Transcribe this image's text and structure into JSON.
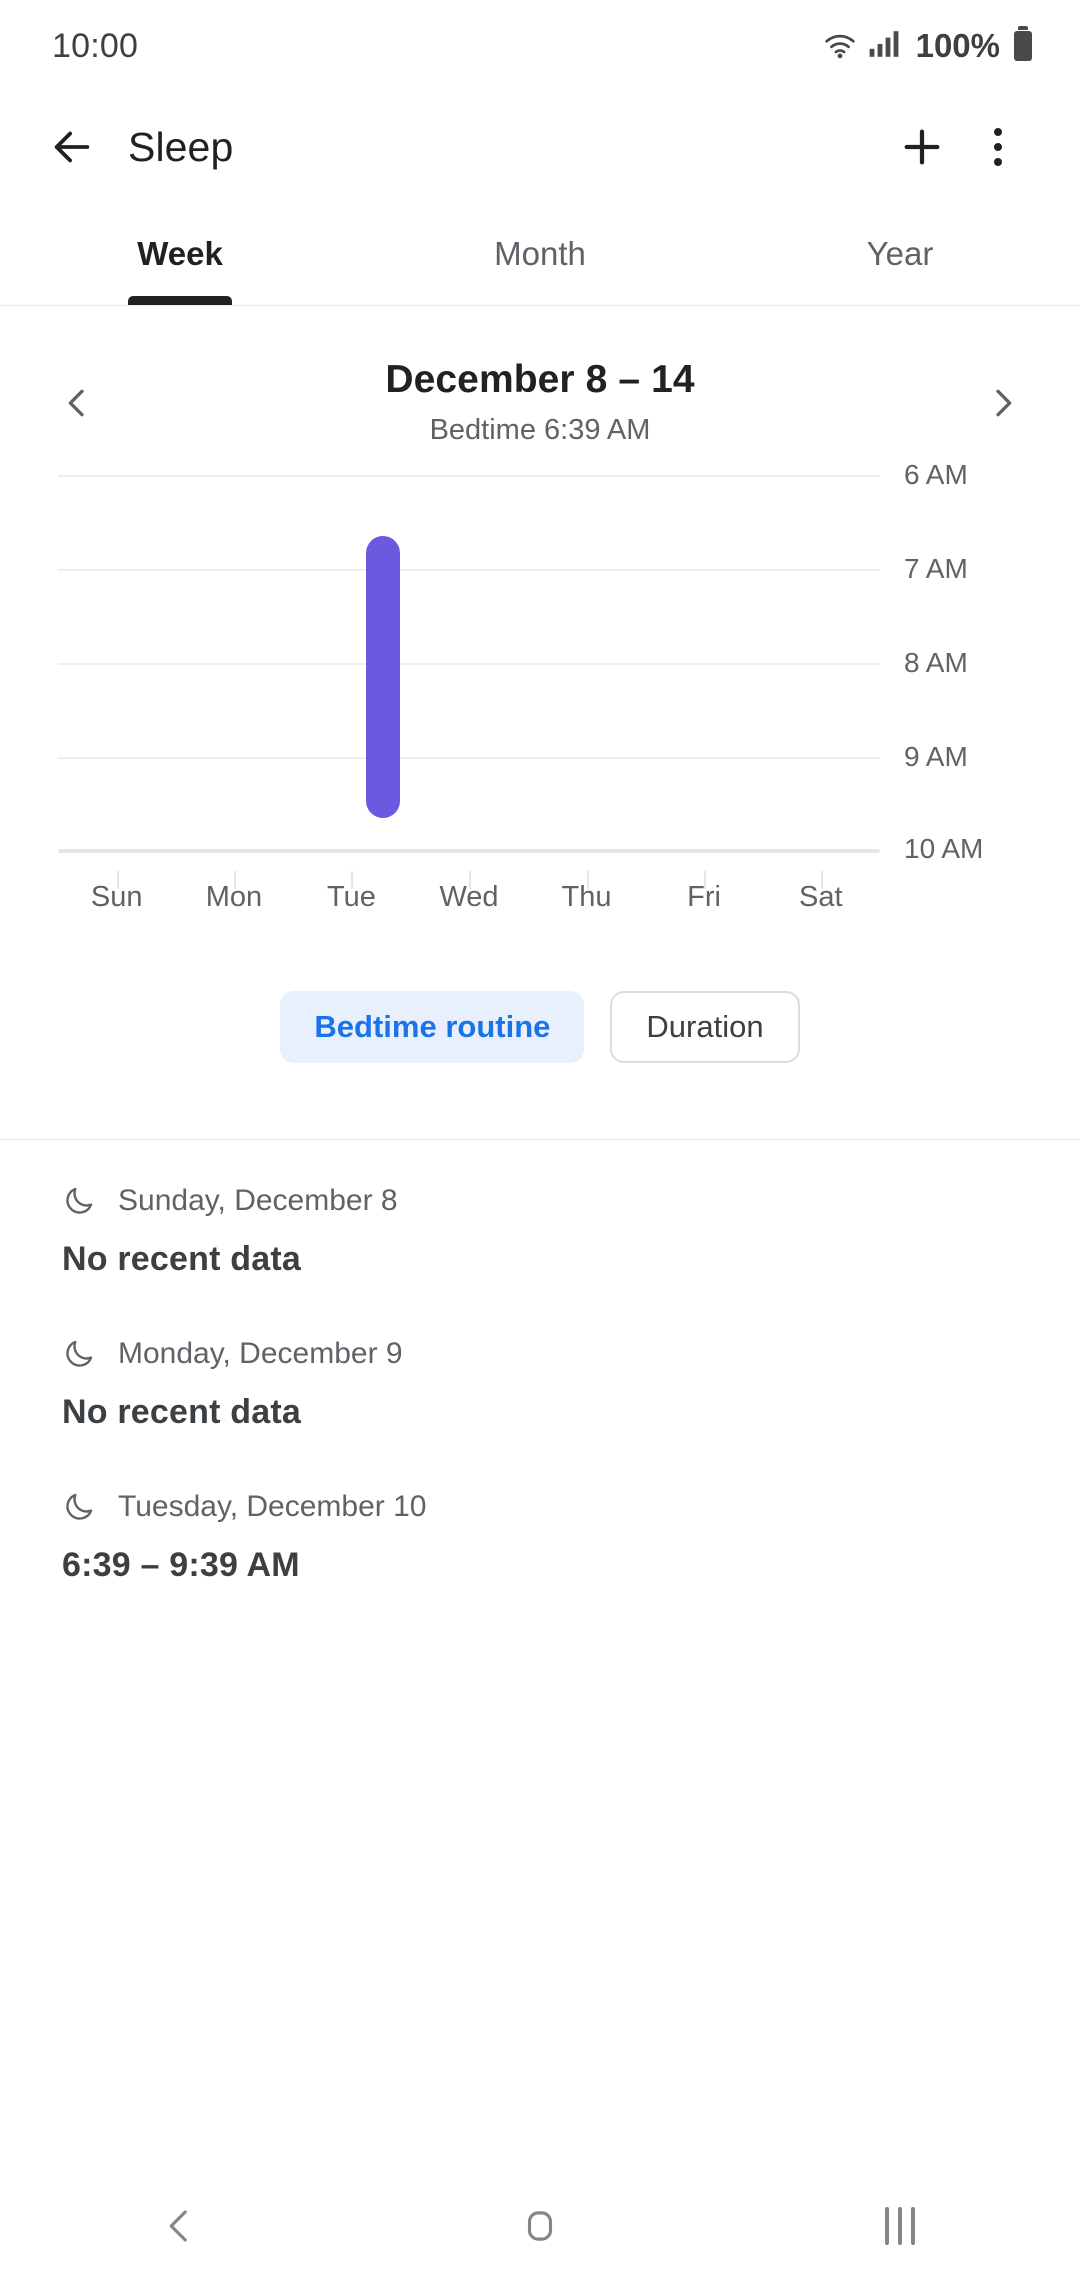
{
  "status_bar": {
    "time": "10:00",
    "battery_percent": "100%",
    "wifi_icon": "wifi-icon",
    "signal_icon": "cellular-signal-icon",
    "battery_icon": "battery-icon"
  },
  "app_bar": {
    "back_icon": "back-arrow-icon",
    "title": "Sleep",
    "add_icon": "plus-icon",
    "overflow_icon": "more-vertical-icon"
  },
  "tabs": [
    {
      "label": "Week",
      "active": true
    },
    {
      "label": "Month",
      "active": false
    },
    {
      "label": "Year",
      "active": false
    }
  ],
  "date_nav": {
    "prev_icon": "chevron-left-icon",
    "next_icon": "chevron-right-icon",
    "title": "December 8 – 14",
    "subtitle": "Bedtime 6:39 AM"
  },
  "chart_data": {
    "type": "bar",
    "title": "December 8 – 14",
    "subtitle": "Bedtime 6:39 AM",
    "xlabel": "",
    "ylabel": "",
    "categories": [
      "Sun",
      "Mon",
      "Tue",
      "Wed",
      "Thu",
      "Fri",
      "Sat"
    ],
    "y_tick_labels": [
      "6 AM",
      "7 AM",
      "8 AM",
      "9 AM",
      "10 AM"
    ],
    "ylim": [
      "6 AM",
      "10 AM"
    ],
    "y_axis_inverted": true,
    "grid": true,
    "legend": "none",
    "bar_color": "#6a5ae0",
    "series": [
      {
        "name": "Bedtime routine",
        "unit": "clock time",
        "values": [
          {
            "category": "Sun",
            "start": null,
            "end": null,
            "label": "No recent data"
          },
          {
            "category": "Mon",
            "start": null,
            "end": null,
            "label": "No recent data"
          },
          {
            "category": "Tue",
            "start": "6:39 AM",
            "end": "9:39 AM",
            "label": "6:39 – 9:39 AM"
          },
          {
            "category": "Wed",
            "start": null,
            "end": null,
            "label": ""
          },
          {
            "category": "Thu",
            "start": null,
            "end": null,
            "label": ""
          },
          {
            "category": "Fri",
            "start": null,
            "end": null,
            "label": ""
          },
          {
            "category": "Sat",
            "start": null,
            "end": null,
            "label": ""
          }
        ]
      }
    ]
  },
  "chips": [
    {
      "label": "Bedtime routine",
      "selected": true
    },
    {
      "label": "Duration",
      "selected": false
    }
  ],
  "entries": [
    {
      "icon": "moon-icon",
      "date": "Sunday, December 8",
      "value": "No recent data"
    },
    {
      "icon": "moon-icon",
      "date": "Monday, December 9",
      "value": "No recent data"
    },
    {
      "icon": "moon-icon",
      "date": "Tuesday, December 10",
      "value": "6:39 – 9:39 AM"
    }
  ],
  "nav_bar": {
    "back_icon": "nav-back-icon",
    "home_icon": "nav-home-icon",
    "recents_icon": "nav-recents-icon"
  },
  "colors": {
    "accent_bar": "#6a5ae0",
    "chip_selected_bg": "#e8f0fe",
    "chip_selected_text": "#1a73e8",
    "text_primary": "#202124",
    "text_secondary": "#5f6368"
  }
}
